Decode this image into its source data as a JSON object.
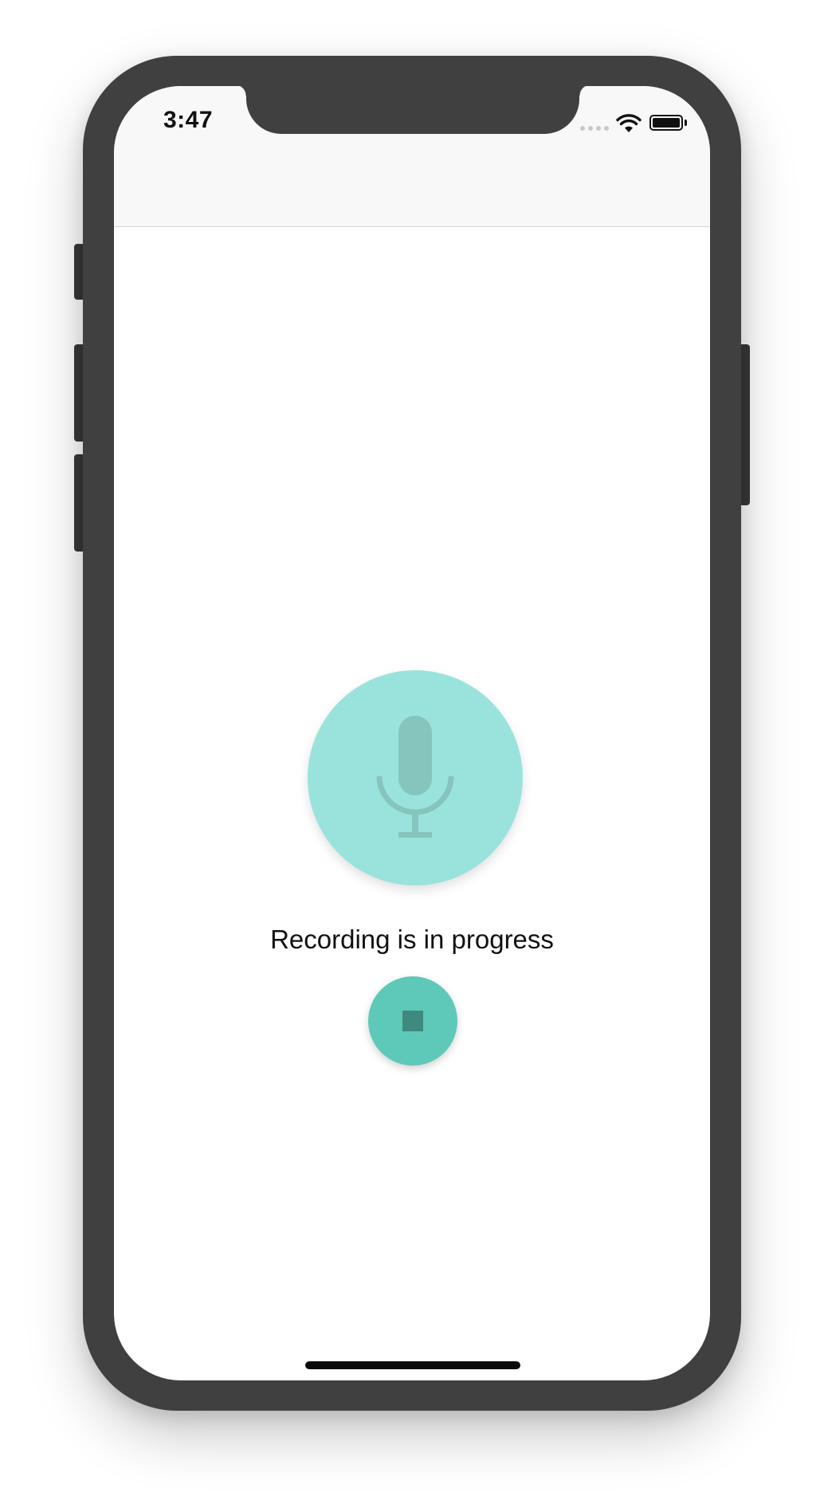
{
  "status_bar": {
    "time": "3:47",
    "icons": [
      "signal-icon",
      "wifi-icon",
      "battery-icon"
    ]
  },
  "recorder": {
    "mic_icon": "microphone-icon",
    "status_text": "Recording is in progress",
    "stop_icon": "stop-icon"
  },
  "colors": {
    "mic_circle": "#9ae3dc",
    "mic_glyph": "#85c5be",
    "stop_button": "#5ec9b9",
    "stop_glyph": "#3e8a7e",
    "frame": "#404040"
  }
}
